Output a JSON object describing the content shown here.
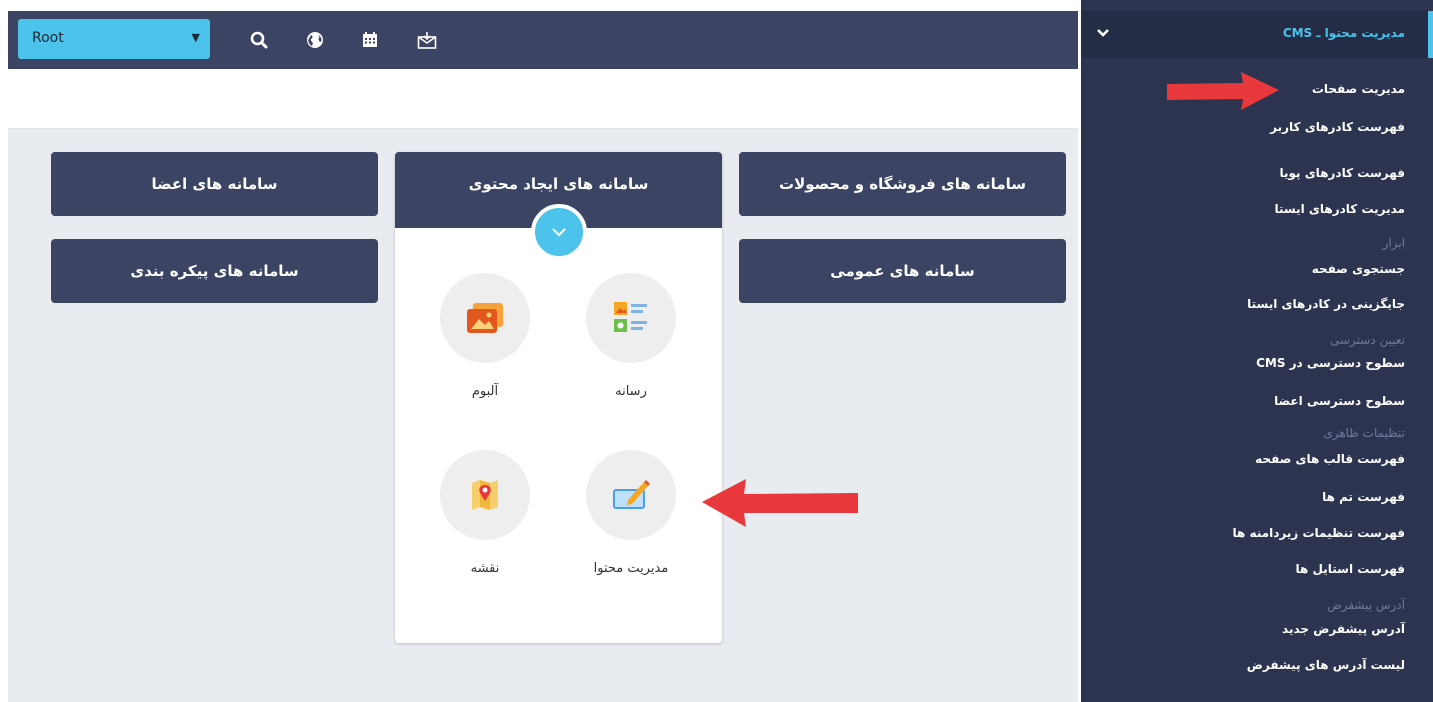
{
  "toolbar": {
    "select_value": "Root",
    "icons": [
      "search-icon",
      "globe-icon",
      "calendar-icon",
      "mail-icon"
    ]
  },
  "cards": {
    "members": "سامانه های اعضا",
    "content": "سامانه های ایجاد محتوی",
    "shop": "سامانه های فروشگاه و محصولات",
    "config": "سامانه های پیکره بندی",
    "general": "سامانه های عمومی"
  },
  "tiles": [
    {
      "label": "رسانه",
      "icon": "media-icon"
    },
    {
      "label": "آلبوم",
      "icon": "album-icon"
    },
    {
      "label": "مدیریت محتوا",
      "icon": "edit-content-icon"
    },
    {
      "label": "نقشه",
      "icon": "map-icon"
    }
  ],
  "sidebar": {
    "title": "مدیریت محتوا ـ CMS",
    "items": {
      "pages": "مدیریت صفحات",
      "user_frames": "فهرست کادرهای کاربر",
      "dynamic_frames": "فهرست کادرهای پویا",
      "static_frames": "مدیریت کادرهای ایستا",
      "tools_group": "ابزار",
      "page_search": "جستجوی صفحه",
      "static_replace": "جایگزینی در کادرهای ایستا",
      "access_group": "تعیین دسترسی",
      "cms_access": "سطوح دسترسی در CMS",
      "member_access": "سطوح دسترسی اعضا",
      "appearance_group": "تنظیمات ظاهری",
      "page_templates": "فهرست قالب های صفحه",
      "themes": "فهرست تم ها",
      "submenu_settings": "فهرست تنظیمات زیردامنه ها",
      "styles": "فهرست استایل ها",
      "default_group": "آدرس پیشفرض",
      "new_default": "آدرس پیشفرض جدید",
      "default_list": "لیست آدرس های پیشفرض"
    }
  },
  "colors": {
    "navy": "#3b4463",
    "sidebar": "#2c3450",
    "accent": "#4cc3ea",
    "arrow": "#e8383b"
  }
}
